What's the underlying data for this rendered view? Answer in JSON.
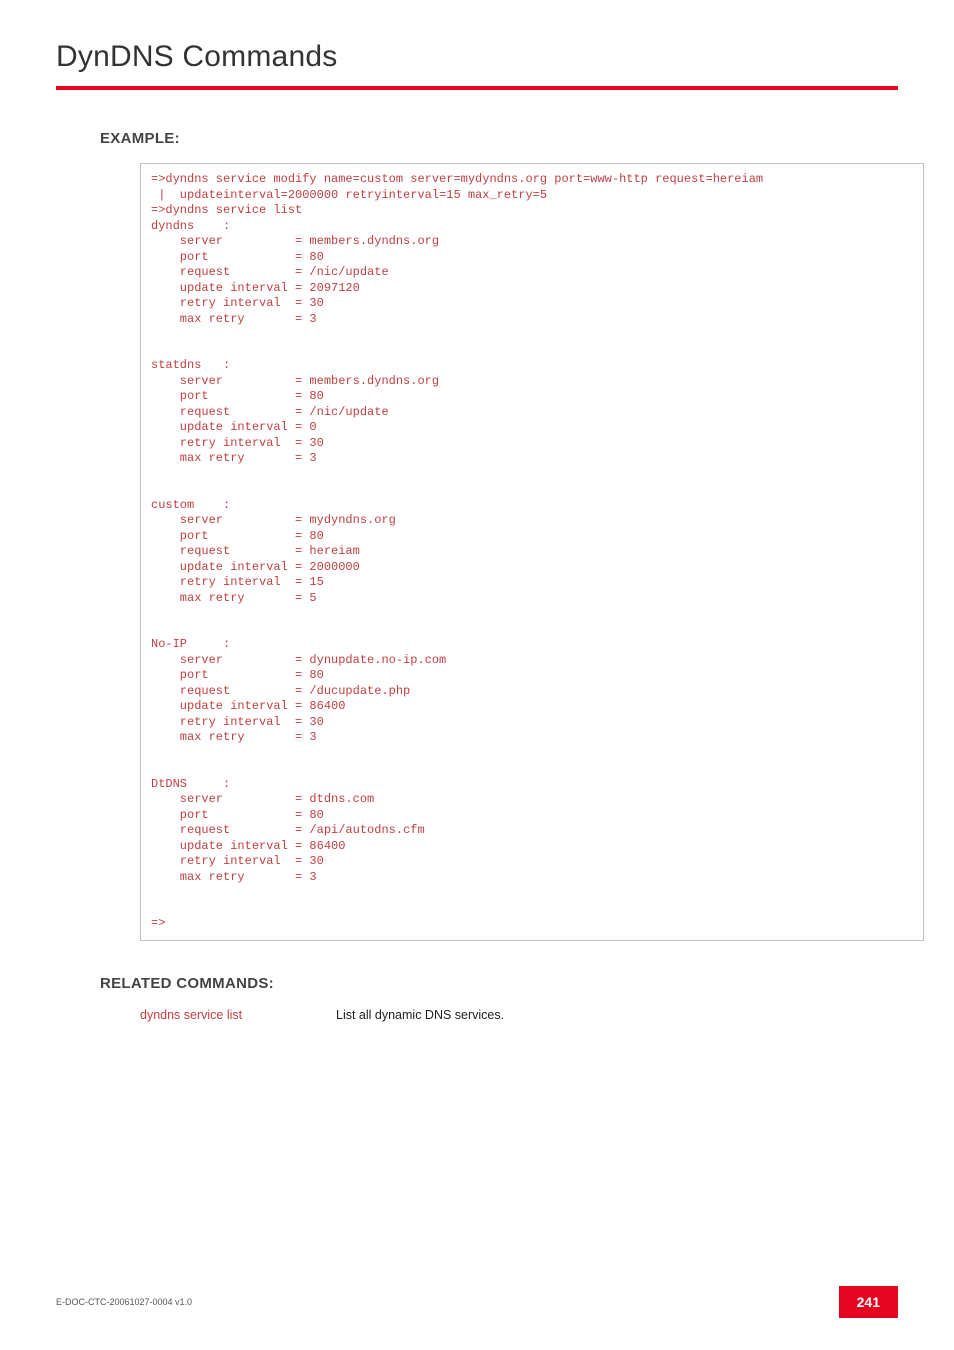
{
  "header": {
    "title": "DynDNS Commands"
  },
  "sections": {
    "example_heading": "EXAMPLE:",
    "related_heading": "RELATED COMMANDS:"
  },
  "code": "=>dyndns service modify name=custom server=mydyndns.org port=www-http request=hereiam\n |  updateinterval=2000000 retryinterval=15 max_retry=5\n=>dyndns service list\ndyndns    :\n    server          = members.dyndns.org\n    port            = 80\n    request         = /nic/update\n    update interval = 2097120\n    retry interval  = 30\n    max retry       = 3\n\n\nstatdns   :\n    server          = members.dyndns.org\n    port            = 80\n    request         = /nic/update\n    update interval = 0\n    retry interval  = 30\n    max retry       = 3\n\n\ncustom    :\n    server          = mydyndns.org\n    port            = 80\n    request         = hereiam\n    update interval = 2000000\n    retry interval  = 15\n    max retry       = 5\n\n\nNo-IP     :\n    server          = dynupdate.no-ip.com\n    port            = 80\n    request         = /ducupdate.php\n    update interval = 86400\n    retry interval  = 30\n    max retry       = 3\n\n\nDtDNS     :\n    server          = dtdns.com\n    port            = 80\n    request         = /api/autodns.cfm\n    update interval = 86400\n    retry interval  = 30\n    max retry       = 3\n\n\n=>",
  "related": {
    "name": "dyndns service list",
    "desc": "List all dynamic DNS services."
  },
  "footer": {
    "docid": "E-DOC-CTC-20061027-0004 v1.0",
    "page": "241"
  }
}
